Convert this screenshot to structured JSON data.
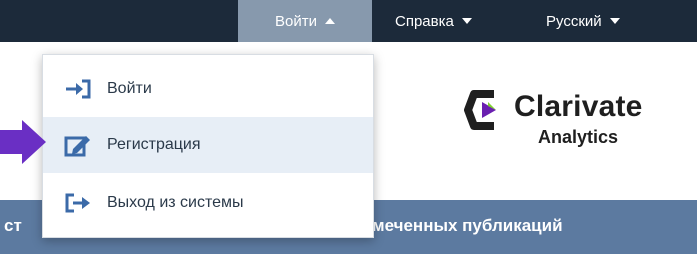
{
  "topbar": {
    "login_label": "Войти",
    "help_label": "Справка",
    "language_label": "Русский"
  },
  "dropdown": {
    "items": [
      {
        "label": "Войти",
        "icon": "sign-in-icon"
      },
      {
        "label": "Регистрация",
        "icon": "edit-register-icon"
      },
      {
        "label": "Выход из системы",
        "icon": "sign-out-icon"
      }
    ],
    "highlighted_index": 1
  },
  "logo": {
    "name": "Clarivate",
    "sub": "Analytics"
  },
  "band": {
    "left_text": "ст",
    "right_text": "меченных публикаций"
  },
  "colors": {
    "topbar": "#1c2a3a",
    "login_active": "#8799ad",
    "band": "#5c7aa0",
    "accent": "#3b6aa8",
    "pointer": "#6a2fc4",
    "logo_purple": "#6a1fb0",
    "logo_green": "#7fd22c"
  }
}
